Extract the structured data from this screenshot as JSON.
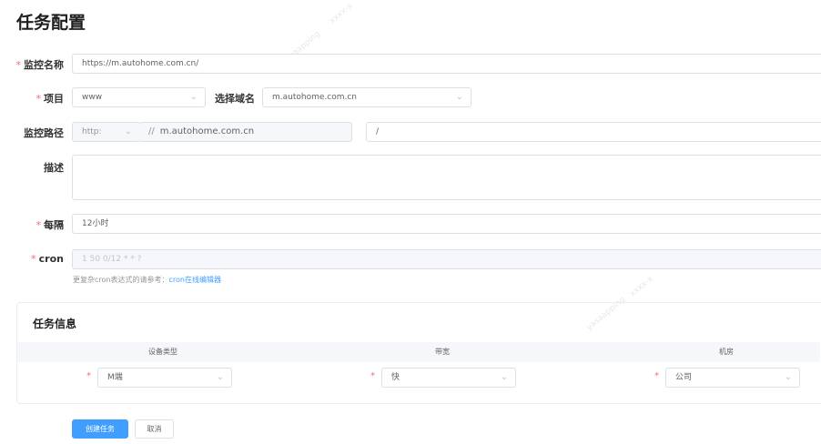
{
  "page": {
    "title": "任务配置"
  },
  "watermarks": [
    "yasaapping",
    "xxxx-x"
  ],
  "form": {
    "monitor_name": {
      "label": "监控名称",
      "required": true,
      "value": "https://m.autohome.com.cn/"
    },
    "project": {
      "label": "项目",
      "required": true,
      "value": "www",
      "chevron_icon": "chevron-down-icon"
    },
    "domain_select": {
      "label": "选择域名",
      "value": "m.autohome.com.cn",
      "chevron_icon": "chevron-down-icon"
    },
    "monitor_path": {
      "label": "监控路径",
      "protocol": "http:",
      "separator": "//",
      "host": "m.autohome.com.cn",
      "path": "/"
    },
    "description": {
      "label": "描述",
      "value": ""
    },
    "interval": {
      "label": "每隔",
      "required": true,
      "value": "12小时"
    },
    "cron": {
      "label": "cron",
      "required": true,
      "placeholder": "1 50 0/12 * * ?"
    },
    "cron_hint": {
      "text": "更复杂cron表达式的请参考：",
      "link": "cron在线编辑器"
    }
  },
  "task_info": {
    "title": "任务信息",
    "columns": [
      "设备类型",
      "带宽",
      "机房"
    ],
    "row": {
      "device_type": "M端",
      "bandwidth": "快",
      "datacenter": "公司"
    }
  },
  "buttons": {
    "create": "创建任务",
    "cancel": "取消"
  },
  "colors": {
    "primary": "#409eff",
    "required": "#f56c6c",
    "border": "#dcdfe6"
  }
}
